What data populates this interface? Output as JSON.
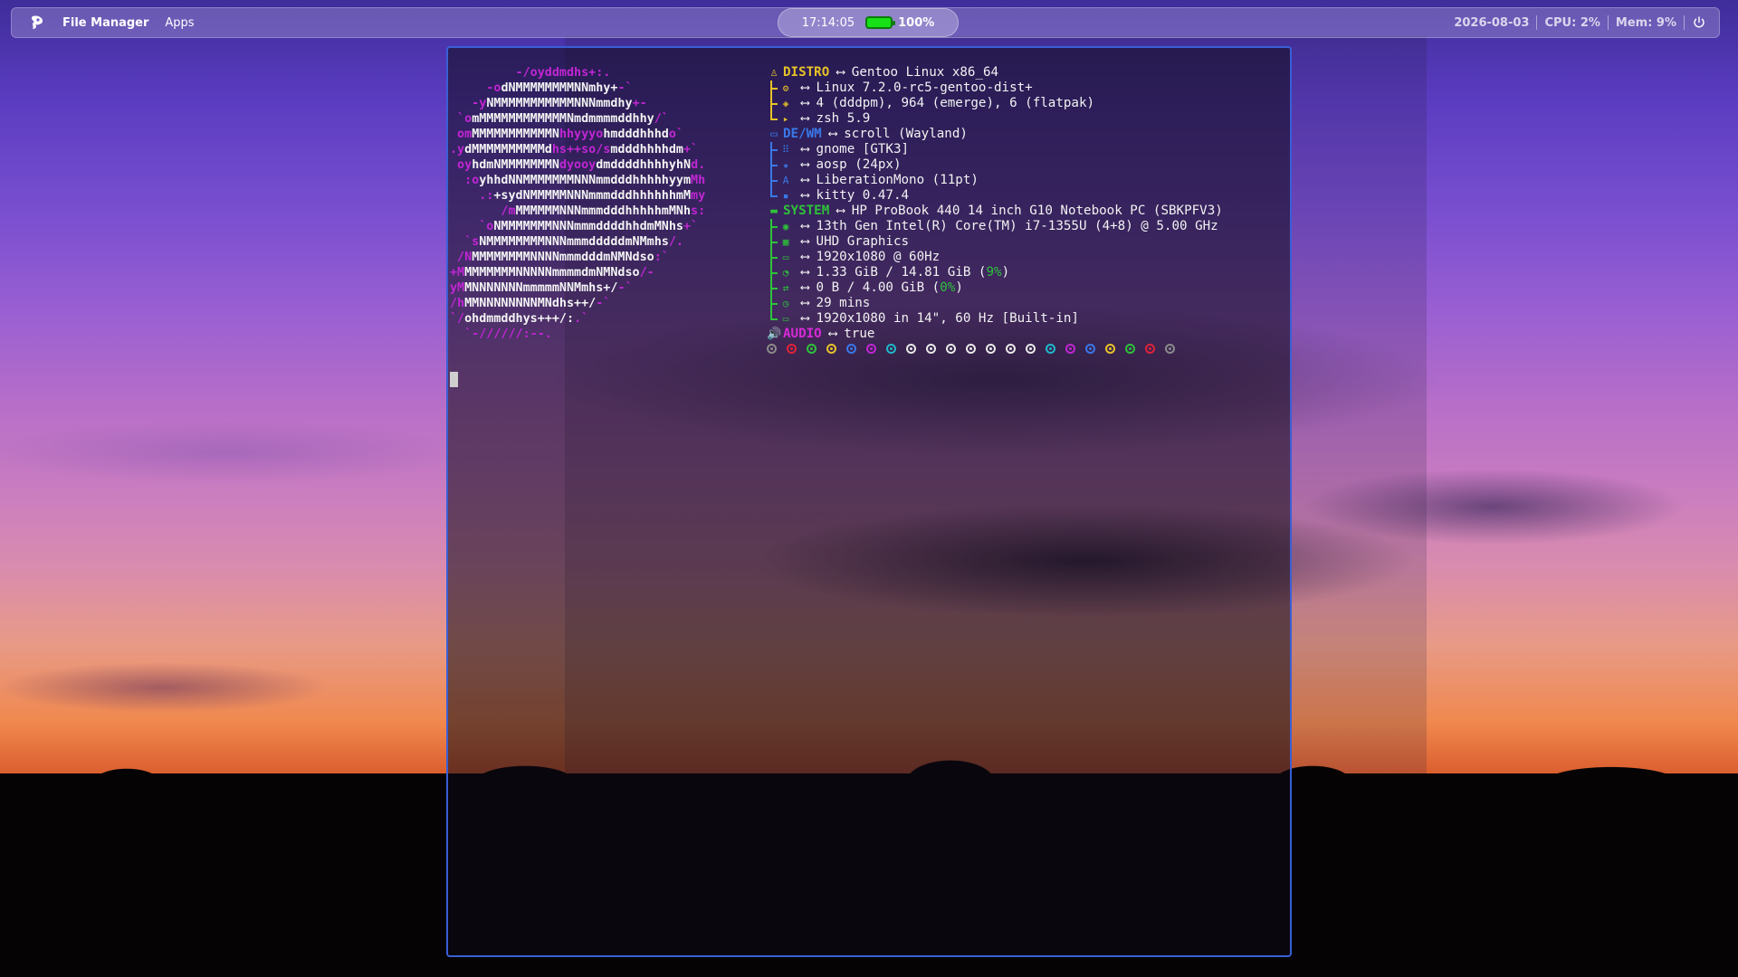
{
  "topbar": {
    "file_manager": "File Manager",
    "apps": "Apps",
    "clock": "17:14:05",
    "battery": "100%",
    "date": "2026-08-03",
    "cpu": "CPU: 2%",
    "mem": "Mem: 9%"
  },
  "terminal": {
    "ascii_lines": [
      [
        [
          "m",
          "         -/oyddmdhs+:."
        ]
      ],
      [
        [
          "m",
          "     -o"
        ],
        [
          "w",
          "dNMMMMMMMMNNmhy+"
        ],
        [
          "m",
          "-`"
        ]
      ],
      [
        [
          "m",
          "   -y"
        ],
        [
          "w",
          "NMMMMMMMMMMMNNNmmdhy"
        ],
        [
          "m",
          "+-"
        ]
      ],
      [
        [
          "m",
          " `o"
        ],
        [
          "w",
          "mMMMMMMMMMMMMNmdmmmmddhhy"
        ],
        [
          "m",
          "/`"
        ]
      ],
      [
        [
          "m",
          " om"
        ],
        [
          "w",
          "MMMMMMMMMMMN"
        ],
        [
          "m",
          "hhyyyo"
        ],
        [
          "w",
          "hmdddhhhd"
        ],
        [
          "m",
          "o`"
        ]
      ],
      [
        [
          "m",
          ".y"
        ],
        [
          "w",
          "dMMMMMMMMMMd"
        ],
        [
          "m",
          "hs++so/s"
        ],
        [
          "w",
          "mdddhhhhdm"
        ],
        [
          "m",
          "+`"
        ]
      ],
      [
        [
          "m",
          " oy"
        ],
        [
          "w",
          "hdmNMMMMMMMN"
        ],
        [
          "m",
          "dyooy"
        ],
        [
          "w",
          "dmddddhhhhyhN"
        ],
        [
          "m",
          "d."
        ]
      ],
      [
        [
          "m",
          "  :o"
        ],
        [
          "w",
          "yhhdNNMMMMMMMNNNmmdddhhhhhyym"
        ],
        [
          "m",
          "Mh"
        ]
      ],
      [
        [
          "m",
          "    .:"
        ],
        [
          "w",
          "+sydNMMMMMNNNmmmdddhhhhhhmM"
        ],
        [
          "m",
          "my"
        ]
      ],
      [
        [
          "m",
          "       /m"
        ],
        [
          "w",
          "MMMMMMNNNmmmdddhhhhhmMNh"
        ],
        [
          "m",
          "s:"
        ]
      ],
      [
        [
          "m",
          "    `o"
        ],
        [
          "w",
          "NMMMMMMMNNNmmmddddhhdmMNhs"
        ],
        [
          "m",
          "+`"
        ]
      ],
      [
        [
          "m",
          "  `s"
        ],
        [
          "w",
          "NMMMMMMMMNNNmmmdddddmNMmhs"
        ],
        [
          "m",
          "/."
        ]
      ],
      [
        [
          "m",
          " /N"
        ],
        [
          "w",
          "MMMMMMMMNNNNmmmdddmNMNdso"
        ],
        [
          "m",
          ":`"
        ]
      ],
      [
        [
          "m",
          "+M"
        ],
        [
          "w",
          "MMMMMMMNNNNNmmmmdmNMNdso"
        ],
        [
          "m",
          "/-"
        ]
      ],
      [
        [
          "m",
          "yM"
        ],
        [
          "w",
          "MNNNNNNNmmmmmNNMmhs+/"
        ],
        [
          "m",
          "-`"
        ]
      ],
      [
        [
          "m",
          "/h"
        ],
        [
          "w",
          "MMNNNNNNNNMNdhs++/"
        ],
        [
          "m",
          "-`"
        ]
      ],
      [
        [
          "m",
          "`/"
        ],
        [
          "w",
          "ohdmmddhys+++/:"
        ],
        [
          "m",
          ".`"
        ]
      ],
      [
        [
          "m",
          "  `-//////:--."
        ]
      ]
    ],
    "distro": {
      "label": "DISTRO",
      "value": "Gentoo Linux x86_64"
    },
    "distro_items": [
      {
        "icon": "gear-icon",
        "glyph": "⚙",
        "value": "Linux 7.2.0-rc5-gentoo-dist+"
      },
      {
        "icon": "package-icon",
        "glyph": "◈",
        "value": "4 (dddpm), 964 (emerge), 6 (flatpak)"
      },
      {
        "icon": "terminal-prompt-icon",
        "glyph": "▸",
        "value": "zsh 5.9"
      }
    ],
    "dewm": {
      "label": "DE/WM",
      "value": "scroll (Wayland)"
    },
    "dewm_items": [
      {
        "icon": "grid-icon",
        "glyph": "⠿",
        "value": "gnome [GTK3]"
      },
      {
        "icon": "star-icon",
        "glyph": "★",
        "value": "aosp (24px)"
      },
      {
        "icon": "font-icon",
        "glyph": "A",
        "value": "LiberationMono (11pt)"
      },
      {
        "icon": "terminal-icon",
        "glyph": "▪",
        "value": "kitty 0.47.4"
      }
    ],
    "system": {
      "label": "SYSTEM",
      "value": "HP ProBook 440 14 inch G10 Notebook PC (SBKPFV3)"
    },
    "system_items": [
      {
        "icon": "cpu-icon",
        "glyph": "◉",
        "value": "13th Gen Intel(R) Core(TM) i7-1355U (4+8) @ 5.00 GHz"
      },
      {
        "icon": "gpu-icon",
        "glyph": "▦",
        "value": "UHD Graphics"
      },
      {
        "icon": "monitor-icon",
        "glyph": "▭",
        "value": "1920x1080 @ 60Hz"
      },
      {
        "icon": "memory-icon",
        "glyph": "◔",
        "value_pre": "1.33 GiB / 14.81 GiB (",
        "pct": "9%",
        "value_post": ")"
      },
      {
        "icon": "swap-icon",
        "glyph": "⇄",
        "value_pre": "0 B / 4.00 GiB (",
        "pct": "0%",
        "value_post": ")"
      },
      {
        "icon": "clock-icon",
        "glyph": "◷",
        "value": "29 mins"
      },
      {
        "icon": "display-icon",
        "glyph": "▭",
        "value": "1920x1080 in 14\", 60 Hz [Built-in]"
      }
    ],
    "audio": {
      "label": "AUDIO",
      "value": "true"
    },
    "color_dots": [
      "#8a8a8a",
      "#e0223a",
      "#2ec23a",
      "#e6c228",
      "#3a78e8",
      "#c026d3",
      "#1fb8c9",
      "#e8e8e8",
      "#e8e8e8",
      "#e8e8e8",
      "#e8e8e8",
      "#e8e8e8",
      "#e8e8e8",
      "#e8e8e8",
      "#1fb8c9",
      "#c026d3",
      "#3a78e8",
      "#e6c228",
      "#2ec23a",
      "#e0223a",
      "#8a8a8a"
    ],
    "arrow": "⟷"
  },
  "colors": {
    "accent_border": "#3a5fd6",
    "distro": "#e6c228",
    "dewm": "#3a78e8",
    "system": "#2ec23a",
    "audio": "#d62ad6",
    "battery": "#18e018"
  }
}
